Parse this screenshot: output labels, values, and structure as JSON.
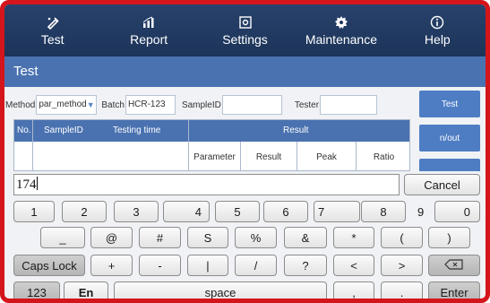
{
  "nav": {
    "tabs": [
      {
        "label": "Test",
        "icon": "test-icon"
      },
      {
        "label": "Report",
        "icon": "chart-icon"
      },
      {
        "label": "Settings",
        "icon": "settings-icon"
      },
      {
        "label": "Maintenance",
        "icon": "gear-icon"
      },
      {
        "label": "Help",
        "icon": "info-icon"
      }
    ]
  },
  "page": {
    "title": "Test"
  },
  "form": {
    "method_label": "Method",
    "method_value": "par_method",
    "batch_label": "Batch",
    "batch_value": "HCR-123",
    "sampleid_label": "SampleID",
    "sampleid_value": "",
    "tester_label": "Tester",
    "tester_value": ""
  },
  "table": {
    "col_no": "No.",
    "col_sampleid": "SampleID",
    "col_testing_time": "Testing time",
    "col_result": "Result",
    "sub_parameter": "Parameter",
    "sub_result": "Result",
    "sub_peak": "Peak",
    "sub_ratio": "Ratio"
  },
  "side": {
    "test_label": "Test",
    "inout_label": "n/out",
    "third_label": ""
  },
  "input": {
    "value": "174"
  },
  "keyboard": {
    "cancel": "Cancel",
    "row1": [
      "1",
      "2",
      "3",
      "4",
      "5",
      "6",
      "7",
      "8",
      "9",
      "0"
    ],
    "row2": [
      "_",
      "@",
      "#",
      "S",
      "%",
      "&",
      "*",
      "(",
      ")"
    ],
    "caps": "Caps Lock",
    "row3": [
      "+",
      "-",
      "|",
      "/",
      "?",
      "<",
      ">"
    ],
    "backspace": "backspace-icon",
    "k123": "123",
    "en": "En",
    "space": "space",
    "comma": ",",
    "period": ".",
    "enter": "Enter"
  },
  "colors": {
    "frame": "#d4151c",
    "nav": "#1d3459",
    "accent": "#4a72b0",
    "side_button": "#4e7dc4"
  }
}
